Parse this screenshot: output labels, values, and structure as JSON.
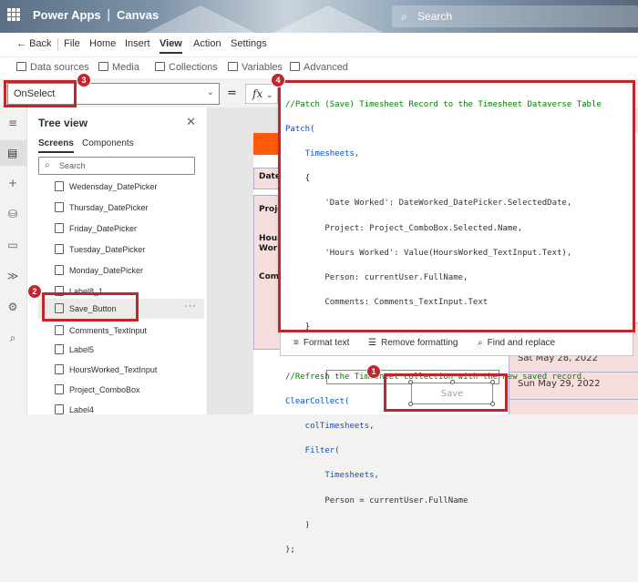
{
  "header": {
    "app_name": "Power Apps",
    "separator": "|",
    "app_mode": "Canvas",
    "search_placeholder": "Search"
  },
  "menu": {
    "back": "Back",
    "items": [
      "File",
      "Home",
      "Insert",
      "View",
      "Action",
      "Settings"
    ],
    "active": "View"
  },
  "ribbon": {
    "items": [
      "Data sources",
      "Media",
      "Collections",
      "Variables",
      "Advanced"
    ]
  },
  "formula_bar": {
    "property": "OnSelect",
    "equals": "=",
    "fx_label": "fx",
    "fx_chevron": "⌄"
  },
  "tree_view": {
    "title": "Tree view",
    "tabs": [
      "Screens",
      "Components"
    ],
    "search_placeholder": "Search",
    "items": [
      "Wedensday_DatePicker",
      "Thursday_DatePicker",
      "Friday_DatePicker",
      "Tuesday_DatePicker",
      "Monday_DatePicker",
      "Label8_1",
      "Save_Button",
      "Comments_TextInput",
      "Label5",
      "HoursWorked_TextInput",
      "Project_ComboBox",
      "Label4"
    ],
    "selected_item": "Save_Button",
    "more": "···"
  },
  "canvas": {
    "labels": [
      "Date",
      "Project",
      "Hours Worked",
      "Comments"
    ],
    "dates": [
      "Sat May 28, 2022",
      "Sun May 29, 2022"
    ],
    "save_label": "Save"
  },
  "formula": {
    "lines": [
      "//Patch (Save) Timesheet Record to the Timesheet Dataverse Table",
      "Patch(",
      "    Timesheets,",
      "    {",
      "        'Date Worked': DateWorked_DatePicker.SelectedDate,",
      "        Project: Project_ComboBox.Selected.Name,",
      "        'Hours Worked': Value(HoursWorked_TextInput.Text),",
      "        Person: currentUser.FullName,",
      "        Comments: Comments_TextInput.Text",
      "    }",
      ");",
      "//Refresh the Timesheet collection with the new saved record.",
      "ClearCollect(",
      "    colTimesheets,",
      "    Filter(",
      "        Timesheets,",
      "        Person = currentUser.FullName",
      "    )",
      ");"
    ]
  },
  "editor_toolbar": {
    "format_text": "Format text",
    "remove_formatting": "Remove formatting",
    "find_replace": "Find and replace"
  },
  "callouts": {
    "one": "1",
    "two": "2",
    "three": "3",
    "four": "4"
  },
  "colors": {
    "accent_red": "#c0272d",
    "orange": "#ff5b0a",
    "pink": "#f7dede",
    "comment_green": "#008000",
    "function_blue": "#0b4fc4",
    "control_purple": "#8b1a8b"
  }
}
